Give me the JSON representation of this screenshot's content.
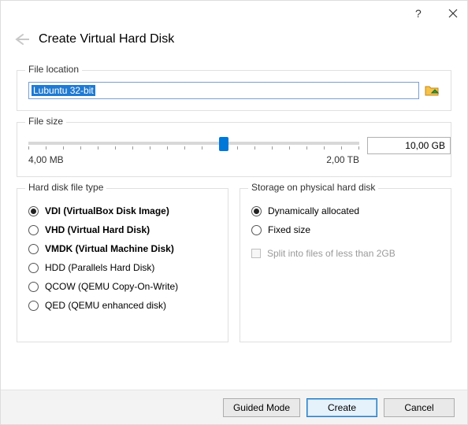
{
  "dialog": {
    "title": "Create Virtual Hard Disk"
  },
  "file_location": {
    "group_label": "File location",
    "value": "Lubuntu 32-bit"
  },
  "file_size": {
    "group_label": "File size",
    "value": "10,00 GB",
    "min_label": "4,00 MB",
    "max_label": "2,00 TB",
    "slider_percent": 59
  },
  "disk_type": {
    "group_label": "Hard disk file type",
    "options": [
      {
        "label": "VDI (VirtualBox Disk Image)",
        "bold": true,
        "selected": true
      },
      {
        "label": "VHD (Virtual Hard Disk)",
        "bold": true,
        "selected": false
      },
      {
        "label": "VMDK (Virtual Machine Disk)",
        "bold": true,
        "selected": false
      },
      {
        "label": "HDD (Parallels Hard Disk)",
        "bold": false,
        "selected": false
      },
      {
        "label": "QCOW (QEMU Copy-On-Write)",
        "bold": false,
        "selected": false
      },
      {
        "label": "QED (QEMU enhanced disk)",
        "bold": false,
        "selected": false
      }
    ]
  },
  "storage": {
    "group_label": "Storage on physical hard disk",
    "options": [
      {
        "label": "Dynamically allocated",
        "selected": true
      },
      {
        "label": "Fixed size",
        "selected": false
      }
    ],
    "split_label": "Split into files of less than 2GB"
  },
  "footer": {
    "guided": "Guided Mode",
    "create": "Create",
    "cancel": "Cancel"
  }
}
